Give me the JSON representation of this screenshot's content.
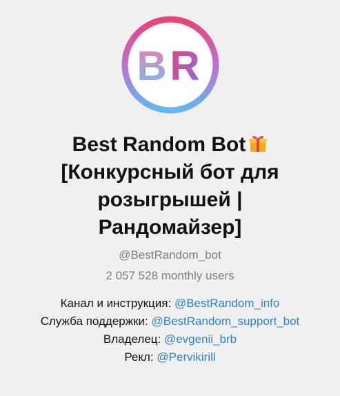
{
  "bot": {
    "avatar_letters": "BR",
    "title_lines": [
      "Best Random Bot",
      "[Конкурсный бот для",
      "розыгрышей |",
      "Рандомайзер]"
    ],
    "handle": "@BestRandom_bot",
    "users": "2 057 528 monthly users"
  },
  "description": [
    {
      "label": "Канал и инструкция: ",
      "link": "@BestRandom_info"
    },
    {
      "label": "Служба поддержки: ",
      "link": "@BestRandom_support_bot"
    },
    {
      "label": "Владелец: ",
      "link": "@evgenii_brb"
    },
    {
      "label": "Рекл: ",
      "link": "@Pervikirill"
    }
  ],
  "colors": {
    "background": "#f0f0f0",
    "link": "#2e7fd0",
    "muted": "#7d7d7d",
    "ring_start": "#e8437a",
    "ring_end": "#5fb8f0"
  },
  "icons": {
    "title_icon": "gift-icon"
  }
}
